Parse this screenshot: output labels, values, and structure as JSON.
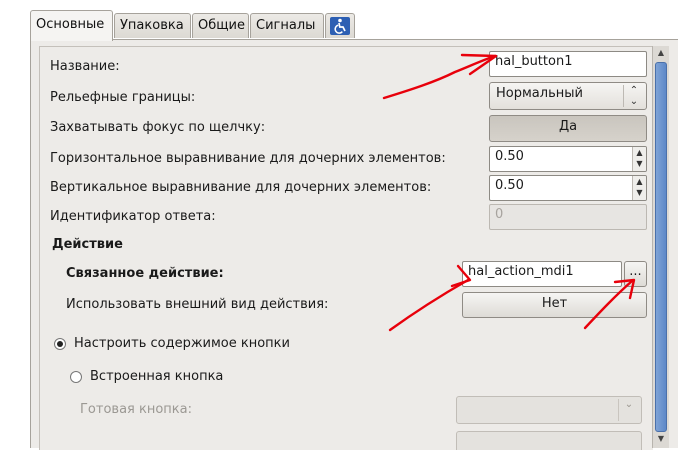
{
  "tabs": [
    {
      "label": "Основные",
      "active": true
    },
    {
      "label": "Упаковка"
    },
    {
      "label": "Общие"
    },
    {
      "label": "Сигналы"
    }
  ],
  "properties": {
    "name_label": "Название:",
    "name_value": "hal_button1",
    "relief_label": "Рельефные границы:",
    "relief_value": "Нормальный",
    "focus_label": "Захватывать фокус по щелчку:",
    "focus_value": "Да",
    "halign_label": "Горизонтальное выравнивание для дочерних элементов:",
    "halign_value": "0.50",
    "valign_label": "Вертикальное выравнивание для дочерних элементов:",
    "valign_value": "0.50",
    "response_label": "Идентификатор ответа:",
    "response_value": "0"
  },
  "action": {
    "section_title": "Действие",
    "related_label": "Связанное действие:",
    "related_value": "hal_action_mdi1",
    "browse_label": "...",
    "use_appearance_label": "Использовать внешний вид действия:",
    "use_appearance_value": "Нет"
  },
  "content": {
    "configure_label": "Настроить содержимое кнопки",
    "builtin_label": "Встроенная кнопка",
    "stock_label": "Готовая кнопка:"
  },
  "colors": {
    "annotation": "#e8000b",
    "scroll_thumb": "#6a92cc"
  }
}
